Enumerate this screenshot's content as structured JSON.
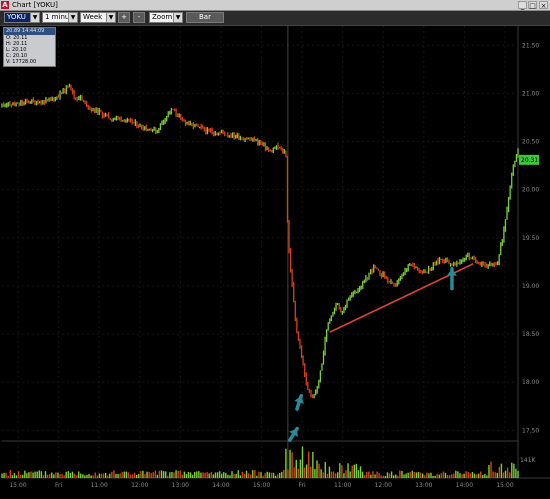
{
  "window": {
    "title": "Chart [YOKU]",
    "controls": {
      "minimize": "_",
      "maximize": "□",
      "close": "×"
    }
  },
  "toolbar": {
    "symbol": "YOKU",
    "interval": "1 minute",
    "period": "Week",
    "zoom_in": "+",
    "zoom_out": "-",
    "zoom_mode": "Zoom",
    "chart_style": "Bar"
  },
  "info_box": {
    "header": "20.89 14:44:09",
    "lines": [
      "O: 20.11",
      "H: 20.11",
      "L: 20.10",
      "C: 20.10",
      "V: 17728.00"
    ]
  },
  "price_axis": {
    "labels": [
      "21.50",
      "21.00",
      "20.50",
      "20.00",
      "19.50",
      "19.00",
      "18.50",
      "18.00",
      "17.50"
    ],
    "current_price": "20.31",
    "volume_label": "141K"
  },
  "time_axis": {
    "labels": [
      "15:00",
      "Fri",
      "11:00",
      "12:00",
      "13:00",
      "14:00",
      "15:00",
      "Fri",
      "11:00",
      "12:00",
      "13:00",
      "14:00",
      "15:00"
    ]
  },
  "colors": {
    "background": "#000000",
    "up_bar": "#7bd135",
    "down_bar": "#d7421b",
    "trendline": "#e0453a",
    "annotation_arrow": "#2a8a98",
    "price_tag": "#3cc83c"
  },
  "chart_data": {
    "type": "line",
    "symbol": "YOKU",
    "interval": "1 minute",
    "ylim": [
      17.4,
      21.7
    ],
    "y_ticks": [
      21.5,
      21.0,
      20.5,
      20.0,
      19.5,
      19.0,
      18.5,
      18.0,
      17.5
    ],
    "series": [
      {
        "name": "",
        "x": [
          0,
          3,
          6,
          8,
          10,
          12,
          13,
          14,
          15,
          17,
          19,
          21,
          24,
          27,
          30,
          33,
          35,
          37,
          40,
          43,
          46,
          49,
          52,
          53,
          54,
          55,
          55.4,
          56,
          57,
          58,
          59,
          60,
          61,
          62,
          63,
          64,
          65,
          66,
          67,
          68,
          70,
          72,
          74,
          76,
          79,
          82,
          85,
          88,
          90,
          92,
          94,
          96,
          97,
          98,
          99,
          100
        ],
        "values": [
          20.88,
          20.89,
          20.92,
          20.91,
          20.94,
          21.02,
          21.1,
          20.95,
          20.96,
          20.84,
          20.8,
          20.74,
          20.72,
          20.66,
          20.61,
          20.84,
          20.71,
          20.66,
          20.61,
          20.58,
          20.55,
          20.52,
          20.4,
          20.45,
          20.42,
          20.39,
          19.5,
          19.13,
          18.57,
          18.3,
          17.97,
          17.84,
          17.92,
          18.18,
          18.59,
          18.71,
          18.82,
          18.71,
          18.88,
          18.91,
          19.03,
          19.19,
          19.1,
          18.99,
          19.22,
          19.14,
          19.28,
          19.21,
          19.32,
          19.26,
          19.21,
          19.23,
          19.5,
          19.86,
          20.25,
          20.41
        ]
      }
    ],
    "annotations": [
      "trendline",
      "up-arrow",
      "up-arrow",
      "up-arrow"
    ]
  }
}
